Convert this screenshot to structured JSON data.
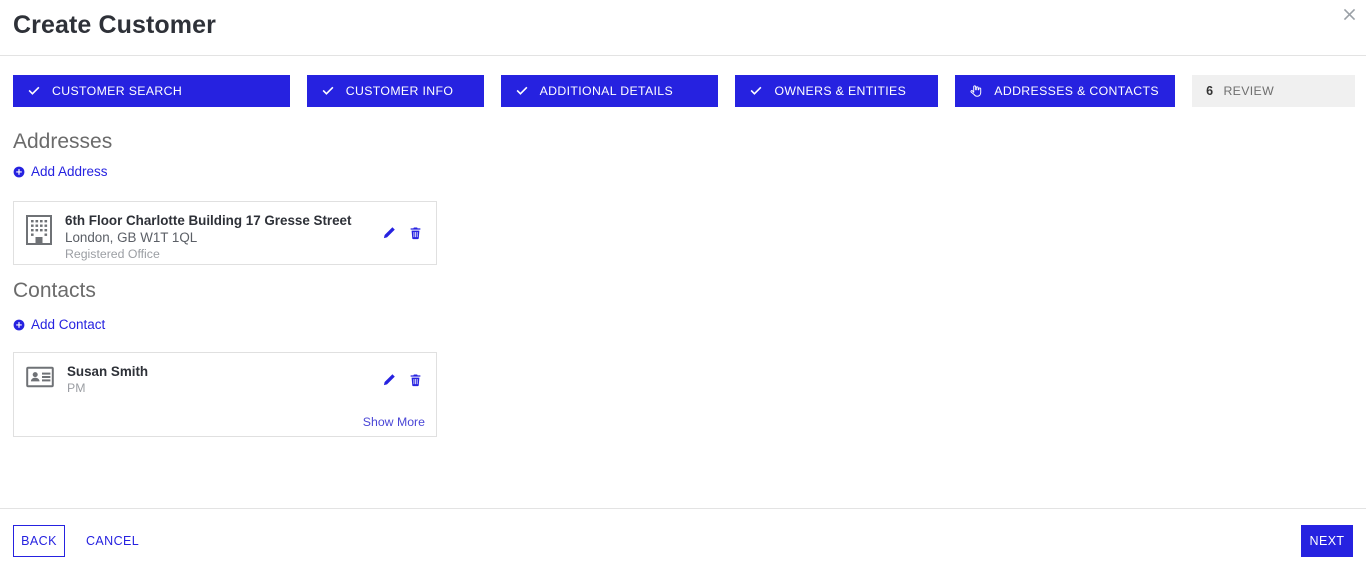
{
  "header": {
    "title": "Create Customer",
    "close_icon": "close-icon"
  },
  "stepper": {
    "steps": [
      {
        "label": "CUSTOMER SEARCH",
        "state": "done",
        "icon": "check-icon",
        "number": "1"
      },
      {
        "label": "CUSTOMER INFO",
        "state": "done",
        "icon": "check-icon",
        "number": "2"
      },
      {
        "label": "ADDITIONAL DETAILS",
        "state": "done",
        "icon": "check-icon",
        "number": "3"
      },
      {
        "label": "OWNERS & ENTITIES",
        "state": "done",
        "icon": "check-icon",
        "number": "4"
      },
      {
        "label": "ADDRESSES & CONTACTS",
        "state": "active",
        "icon": "hand-pointer-icon",
        "number": "5"
      },
      {
        "label": "REVIEW",
        "state": "todo",
        "icon": "step-number",
        "number": "6"
      }
    ]
  },
  "addresses": {
    "title": "Addresses",
    "add_label": "Add Address",
    "add_icon": "plus-circle-icon",
    "card": {
      "icon": "building-icon",
      "street": "6th Floor Charlotte Building 17 Gresse Street",
      "locality": "London, GB W1T 1QL",
      "type": "Registered Office",
      "edit_icon": "pencil-icon",
      "delete_icon": "trash-icon"
    }
  },
  "contacts": {
    "title": "Contacts",
    "add_label": "Add Contact",
    "add_icon": "plus-circle-icon",
    "card": {
      "icon": "contact-card-icon",
      "name": "Susan Smith",
      "role": "PM",
      "edit_icon": "pencil-icon",
      "delete_icon": "trash-icon",
      "show_more_label": "Show More"
    }
  },
  "footer": {
    "back_label": "BACK",
    "cancel_label": "CANCEL",
    "next_label": "NEXT"
  },
  "colors": {
    "accent": "#2622e0",
    "title_text": "#2e3138",
    "muted_text": "#9b9ea3",
    "step_todo_bg": "#f0f0f0",
    "border": "#e0e0e0"
  }
}
